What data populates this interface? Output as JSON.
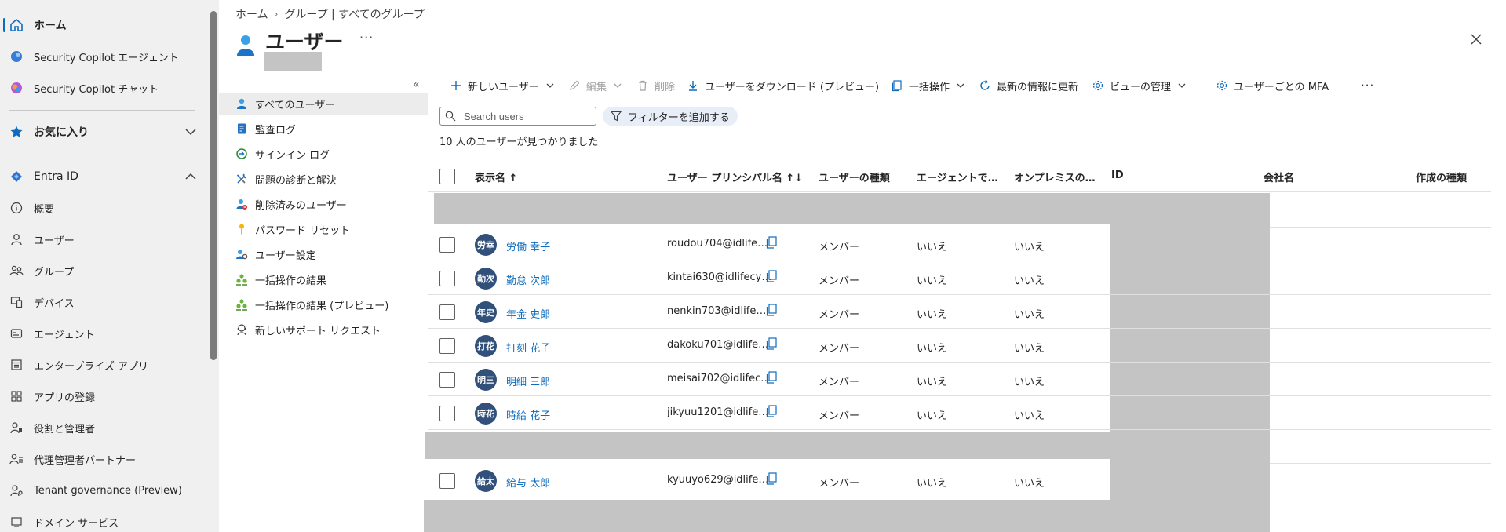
{
  "leftnav": {
    "home": "ホーム",
    "copilot_agent": "Security Copilot エージェント",
    "copilot_chat": "Security Copilot チャット",
    "favorites": "お気に入り",
    "entra": "Entra ID",
    "items": [
      "概要",
      "ユーザー",
      "グループ",
      "デバイス",
      "エージェント",
      "エンタープライズ アプリ",
      "アプリの登録",
      "役割と管理者",
      "代理管理者パートナー",
      "Tenant governance (Preview)",
      "ドメイン サービス"
    ]
  },
  "breadcrumb": [
    "ホーム",
    "グループ | すべてのグループ"
  ],
  "page": {
    "title": "ユーザー",
    "more": "···"
  },
  "subnav": [
    "すべてのユーザー",
    "監査ログ",
    "サインイン ログ",
    "問題の診断と解決",
    "削除済みのユーザー",
    "パスワード リセット",
    "ユーザー設定",
    "一括操作の結果",
    "一括操作の結果 (プレビュー)",
    "新しいサポート リクエスト"
  ],
  "toolbar": {
    "new_user": "新しいユーザー",
    "edit": "編集",
    "delete": "削除",
    "download": "ユーザーをダウンロード (プレビュー)",
    "bulk": "一括操作",
    "refresh": "最新の情報に更新",
    "manage_view": "ビューの管理",
    "mfa": "ユーザーごとの MFA",
    "more": "···"
  },
  "search": {
    "placeholder": "Search users"
  },
  "filter": {
    "label": "フィルターを追加する"
  },
  "result_count": "10 人のユーザーが見つかりました",
  "columns": {
    "display_name": "表示名 ↑",
    "upn": "ユーザー プリンシパル名 ↑↓",
    "user_type": "ユーザーの種類",
    "agent": "エージェントで…",
    "onprem": "オンプレミスの…",
    "id": "ID",
    "company": "会社名",
    "creation": "作成の種類"
  },
  "rows": [
    {
      "initials": "労幸",
      "name": "労働 幸子",
      "upn": "roudou704@idlife…",
      "type": "メンバー",
      "agent": "いいえ",
      "onprem": "いいえ"
    },
    {
      "initials": "勤次",
      "name": "勤怠 次郎",
      "upn": "kintai630@idlifecy…",
      "type": "メンバー",
      "agent": "いいえ",
      "onprem": "いいえ"
    },
    {
      "initials": "年史",
      "name": "年金 史郎",
      "upn": "nenkin703@idlife…",
      "type": "メンバー",
      "agent": "いいえ",
      "onprem": "いいえ"
    },
    {
      "initials": "打花",
      "name": "打刻 花子",
      "upn": "dakoku701@idlife…",
      "type": "メンバー",
      "agent": "いいえ",
      "onprem": "いいえ"
    },
    {
      "initials": "明三",
      "name": "明細 三郎",
      "upn": "meisai702@idlifec…",
      "type": "メンバー",
      "agent": "いいえ",
      "onprem": "いいえ"
    },
    {
      "initials": "時花",
      "name": "時給 花子",
      "upn": "jikyuu1201@idlife…",
      "type": "メンバー",
      "agent": "いいえ",
      "onprem": "いいえ"
    },
    {
      "initials": "給太",
      "name": "給与 太郎",
      "upn": "kyuuyo629@idlife…",
      "type": "メンバー",
      "agent": "いいえ",
      "onprem": "いいえ"
    }
  ],
  "colors": {
    "accent": "#0f6cbd",
    "avatar": "#31507a",
    "redact": "#c4c4c4"
  }
}
